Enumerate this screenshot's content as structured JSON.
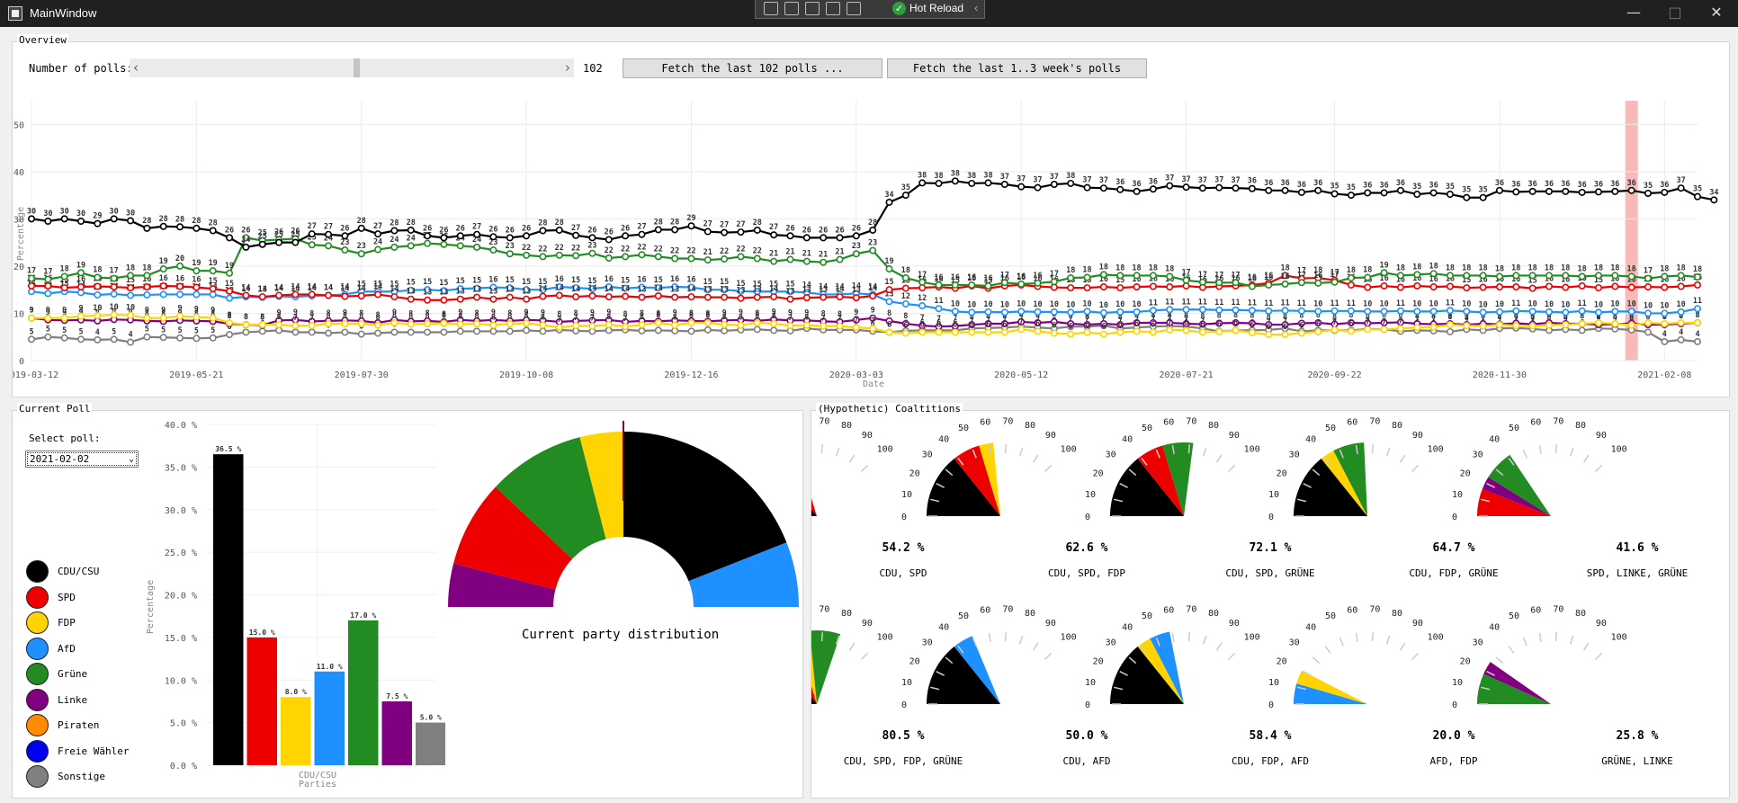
{
  "window": {
    "title": "MainWindow",
    "hot_reload": "Hot Reload",
    "minimize": "—",
    "maximize": "□",
    "close": "✕",
    "dev_icons": [
      "select-element-icon",
      "display-target-icon",
      "track-focus-icon",
      "layout-adorner-icon",
      "binding-failure-icon"
    ]
  },
  "overview": {
    "title": "Overview",
    "polls_label": "Number of polls:",
    "slider_value": "102",
    "slider_fraction": 0.51,
    "fetch_button": "Fetch the last 102 polls ...",
    "weeks_button": "Fetch the last 1..3 week's polls"
  },
  "chart": {
    "ylabel": "Percentage",
    "xlabel": "Date",
    "y_ticks": [
      "0",
      "10",
      "20",
      "30",
      "40",
      "50"
    ],
    "ylim": [
      0,
      55
    ],
    "x_ticks": [
      "2019-03-12",
      "2019-05-21",
      "2019-07-30",
      "2019-10-08",
      "2019-12-16",
      "2020-03-03",
      "2020-05-12",
      "2020-07-21",
      "2020-09-22",
      "2020-11-30",
      "2021-02-08"
    ],
    "highlight_index": 97
  },
  "chart_data": {
    "type": "line",
    "n": 102,
    "series": [
      {
        "name": "CDU/CSU",
        "color": "#000000",
        "values": [
          30,
          29.5,
          30,
          29.5,
          29,
          30,
          29.6,
          28,
          28.4,
          28.3,
          28,
          27.5,
          26,
          24,
          24.6,
          25,
          25,
          26.8,
          26.7,
          26.4,
          28,
          26.8,
          27.5,
          27.6,
          26.4,
          26,
          26.4,
          26.7,
          26.2,
          26,
          26.4,
          27.5,
          27.6,
          26.5,
          26,
          25.6,
          26.4,
          26.7,
          27.7,
          27.7,
          28.5,
          27.3,
          27.1,
          27.2,
          27.6,
          26.6,
          26.4,
          26,
          26,
          26,
          26.4,
          27.6,
          33.5,
          35,
          37.6,
          37.5,
          38,
          37.5,
          37.6,
          37.3,
          36.8,
          36.6,
          37.3,
          37.5,
          36.6,
          36.5,
          36.2,
          35.8,
          36.3,
          37,
          36.7,
          36.5,
          36.6,
          36.5,
          36.4,
          36,
          36,
          35.6,
          36,
          35.3,
          35,
          35.5,
          35.5,
          36,
          35.2,
          35.5,
          35.2,
          34.5,
          34.5,
          36,
          35.7,
          35.8,
          35.8,
          35.8,
          35.6,
          35.7,
          35.8,
          36,
          35.4,
          35.6,
          36.5,
          34.7,
          34
        ]
      },
      {
        "name": "SPD",
        "color": "#ee0000",
        "values": [
          15.8,
          15.8,
          15.4,
          15.6,
          15.7,
          15.6,
          15.4,
          15.6,
          15.8,
          15.7,
          15.5,
          15.2,
          14.7,
          13.8,
          13.5,
          13.8,
          14,
          14,
          13.8,
          13.6,
          13.7,
          14,
          13.5,
          13,
          12.8,
          12.8,
          13,
          13.4,
          13,
          13.4,
          13,
          13.6,
          13.8,
          13.5,
          13.7,
          13.5,
          13.6,
          13.4,
          13.7,
          13.4,
          13.5,
          13.4,
          13.4,
          13.2,
          13.4,
          13.5,
          13,
          13.3,
          13.4,
          13.5,
          13.3,
          13.7,
          15,
          15.3,
          15.4,
          15.6,
          15.3,
          15.8,
          15.3,
          15.8,
          16,
          15.7,
          15.5,
          15.4,
          15.4,
          15.6,
          15.4,
          15.6,
          15.7,
          15.6,
          15.8,
          15.5,
          15.7,
          15.8,
          16,
          16.4,
          18,
          17.4,
          17.5,
          17,
          16,
          15.5,
          15.8,
          15.5,
          15.8,
          15.6,
          15.7,
          15.4,
          15.5,
          15.6,
          15.6,
          15.3,
          15.7,
          15.5,
          15.8,
          15.4,
          15.7,
          15.5,
          15.6,
          15.5,
          15.7,
          16
        ]
      },
      {
        "name": "FDP",
        "color": "#ffd400",
        "values": [
          9,
          9,
          9,
          9.4,
          9.5,
          9.7,
          9.6,
          9,
          9,
          9.4,
          9.2,
          9,
          8,
          7.6,
          7.6,
          7.6,
          7.4,
          7.4,
          7.8,
          7.8,
          7.8,
          7.5,
          8,
          7.7,
          7.8,
          7.9,
          7.7,
          7.8,
          7.5,
          7.8,
          7.9,
          7.5,
          7,
          7.4,
          7.3,
          7.6,
          7.2,
          7.6,
          8,
          7.5,
          8,
          8,
          7.6,
          7.5,
          8,
          7.8,
          7.4,
          7.5,
          7.3,
          7.3,
          7,
          6.8,
          6,
          5.8,
          6,
          6,
          6,
          6,
          6,
          6,
          6.6,
          6.2,
          5.8,
          5.6,
          6,
          5.6,
          6,
          6.2,
          6,
          6.5,
          6.4,
          6,
          6.1,
          6.4,
          5.9,
          5.5,
          5.5,
          5.8,
          6.1,
          6.5,
          6.2,
          6.6,
          6.6,
          6.8,
          7,
          7.1,
          7.6,
          7.4,
          7.3,
          7.6,
          7.4,
          7.3,
          7.5,
          7.6,
          7.8,
          8,
          7.8,
          7.5,
          8,
          7.8,
          8,
          8
        ]
      },
      {
        "name": "AfD",
        "color": "#1e90ff",
        "values": [
          14.6,
          14.2,
          14.6,
          14.4,
          13.9,
          14.1,
          13.8,
          13.9,
          14,
          14,
          14,
          14,
          13.2,
          13.5,
          13.4,
          13.6,
          13.5,
          13.7,
          13.8,
          14,
          14.6,
          14.6,
          14.6,
          14.9,
          15,
          14.8,
          15.2,
          15.3,
          15.5,
          15.4,
          15,
          15,
          15.6,
          15.4,
          15.2,
          15.6,
          15.3,
          15.5,
          15.4,
          15.6,
          15.5,
          15,
          15,
          14.7,
          14.6,
          14.6,
          14.6,
          14.4,
          14,
          14,
          14.2,
          14,
          12.5,
          12,
          11.6,
          11,
          10.4,
          10.2,
          10.3,
          10.2,
          10.4,
          10.3,
          10.3,
          10.2,
          10.4,
          10.1,
          10.3,
          10.3,
          10.6,
          10.8,
          10.8,
          10.8,
          10.7,
          10.7,
          10.6,
          10.5,
          10.6,
          10.5,
          10.4,
          10.5,
          10.5,
          10.4,
          10.4,
          10.5,
          10.4,
          10.4,
          10.6,
          10.4,
          10.2,
          10.3,
          10.5,
          10.4,
          10.3,
          10.2,
          10.5,
          10.2,
          10.4,
          10.4,
          10,
          10,
          10.3,
          11
        ]
      },
      {
        "name": "Grüne",
        "color": "#228b22",
        "values": [
          17.4,
          17.2,
          17.8,
          18.6,
          17.6,
          17.4,
          18,
          18,
          19.4,
          20,
          19,
          19,
          18.5,
          26,
          25.4,
          25.6,
          25.8,
          24.5,
          24.3,
          23.4,
          22.6,
          23.5,
          24,
          24.3,
          24.8,
          24.6,
          24.3,
          24,
          23.4,
          22.6,
          22.3,
          22,
          22.3,
          22.2,
          22.7,
          21.7,
          22,
          22.4,
          22,
          21.6,
          21.6,
          21.3,
          21.5,
          22,
          21.6,
          21,
          21.4,
          21,
          20.8,
          21.4,
          22.6,
          23.3,
          19.4,
          17.5,
          16.6,
          16,
          16,
          16,
          15.8,
          16.5,
          16.2,
          16.4,
          16.7,
          17.5,
          17.6,
          18.2,
          18,
          18,
          18,
          17.8,
          17,
          16.6,
          16.5,
          16.5,
          15.7,
          16,
          16.2,
          16.5,
          16.4,
          16.6,
          17.5,
          17.6,
          18.6,
          18,
          18.2,
          18.4,
          18,
          18,
          18,
          17.8,
          18,
          18,
          18,
          18,
          17.8,
          18,
          18,
          17.8,
          17.4,
          17.8,
          18,
          17.7
        ]
      },
      {
        "name": "Linke",
        "color": "#800080",
        "values": [
          9,
          8.6,
          8.5,
          8.6,
          8.4,
          8.7,
          8.6,
          8.4,
          8.3,
          8.5,
          8.4,
          8.3,
          7.8,
          7.6,
          7.5,
          8.5,
          8.6,
          8.3,
          8.4,
          8.5,
          8.4,
          8,
          8.6,
          8.3,
          8.4,
          8.2,
          8.6,
          8.4,
          8.6,
          8.4,
          8.6,
          8.5,
          8.2,
          8.4,
          8.5,
          8.6,
          8.2,
          8.4,
          8.3,
          8.5,
          8.4,
          8.3,
          8.5,
          8.6,
          8.4,
          8.7,
          8.5,
          8.5,
          8.3,
          8.2,
          8.6,
          9,
          8.4,
          7.8,
          7.4,
          7.2,
          7.3,
          7.6,
          7.8,
          7.8,
          8.2,
          8,
          8.2,
          7.8,
          7.6,
          7.8,
          7.6,
          8,
          8,
          8,
          7.8,
          7.7,
          7.9,
          8,
          7.9,
          7.6,
          7.6,
          7.9,
          8,
          7.7,
          8,
          7.9,
          8,
          8.1,
          7.8,
          7.7,
          7.8,
          7.6,
          7.8,
          7.7,
          7.9,
          7.7,
          8,
          7.8,
          7.8,
          7.6,
          7.7,
          7.9,
          7.6,
          7.6,
          7.8,
          8
        ]
      },
      {
        "name": "Sonstige",
        "color": "#808080",
        "values": [
          4.5,
          5,
          4.8,
          4.5,
          4.4,
          4.5,
          3.9,
          5,
          4.9,
          4.8,
          4.7,
          4.8,
          5.5,
          6,
          6.2,
          6.4,
          6,
          6,
          5.8,
          6,
          5.6,
          5.8,
          6,
          6,
          6,
          6,
          6.2,
          6.2,
          6.2,
          6.2,
          6.4,
          6.2,
          6.5,
          6.3,
          6.2,
          6.4,
          6.5,
          6.3,
          6.4,
          6.3,
          6.2,
          6.5,
          6.3,
          6.5,
          6.6,
          6.4,
          6.3,
          6.8,
          6.5,
          6.5,
          6.5,
          6.2,
          6,
          6.3,
          6.4,
          6.4,
          6.4,
          6.8,
          6.9,
          7,
          7.2,
          7,
          6.8,
          7.2,
          7.2,
          7.4,
          6.8,
          7,
          7.2,
          7.3,
          7.2,
          6.8,
          6.2,
          6.4,
          6.4,
          6.5,
          6.8,
          6.2,
          6.4,
          6.4,
          6.4,
          6.7,
          6.6,
          6.2,
          6.4,
          6.3,
          6.1,
          6.6,
          6.4,
          6.8,
          6.9,
          6.7,
          6.4,
          6.6,
          6.4,
          6.8,
          6.7,
          6.5,
          6,
          4,
          4.4,
          4
        ]
      }
    ]
  },
  "current_poll": {
    "title": "Current Poll",
    "select_label": "Select poll:",
    "select_value": "2021-02-02",
    "legend": [
      {
        "name": "CDU/CSU",
        "color": "#000000"
      },
      {
        "name": "SPD",
        "color": "#ee0000"
      },
      {
        "name": "FDP",
        "color": "#ffd400"
      },
      {
        "name": "AfD",
        "color": "#1e90ff"
      },
      {
        "name": "Grüne",
        "color": "#228b22"
      },
      {
        "name": "Linke",
        "color": "#800080"
      },
      {
        "name": "Piraten",
        "color": "#ff8c00"
      },
      {
        "name": "Freie Wähler",
        "color": "#0000ee"
      },
      {
        "name": "Sonstige",
        "color": "#808080"
      }
    ],
    "bar_chart": {
      "ylabel": "Percentage",
      "xlabel": "Parties",
      "x_tick": "CDU/CSU",
      "y_ticks": [
        "0.0 %",
        "5.0 %",
        "10.0 %",
        "15.0 %",
        "20.0 %",
        "25.0 %",
        "30.0 %",
        "35.0 %",
        "40.0 %"
      ],
      "ylim": [
        0,
        40
      ],
      "bars": [
        {
          "label": "36.5 %",
          "value": 36.5,
          "color": "#000000"
        },
        {
          "label": "15.0 %",
          "value": 15.0,
          "color": "#ee0000"
        },
        {
          "label": "8.0 %",
          "value": 8.0,
          "color": "#ffd400"
        },
        {
          "label": "11.0 %",
          "value": 11.0,
          "color": "#1e90ff"
        },
        {
          "label": "17.0 %",
          "value": 17.0,
          "color": "#228b22"
        },
        {
          "label": "7.5 %",
          "value": 7.5,
          "color": "#800080"
        },
        {
          "label": "5.0 %",
          "value": 5.0,
          "color": "#808080"
        }
      ]
    },
    "distribution_title": "Current party distribution",
    "distribution": [
      {
        "name": "Linke",
        "value": 8,
        "color": "#800080"
      },
      {
        "name": "SPD",
        "value": 16,
        "color": "#ee0000"
      },
      {
        "name": "Grüne",
        "value": 18,
        "color": "#228b22"
      },
      {
        "name": "FDP",
        "value": 8,
        "color": "#ffd400"
      },
      {
        "name": "CDU/CSU",
        "value": 38,
        "color": "#000000"
      },
      {
        "name": "AfD",
        "value": 12,
        "color": "#1e90ff"
      }
    ]
  },
  "coalitions": {
    "title": "(Hypothetic) Coaltitions",
    "gauges": [
      {
        "total": "54.2 %",
        "parties": "CDU, SPD",
        "segments": [
          {
            "v": 38,
            "c": "#000000"
          },
          {
            "v": 16.2,
            "c": "#ee0000"
          }
        ]
      },
      {
        "total": "62.6 %",
        "parties": "CDU, SPD, FDP",
        "segments": [
          {
            "v": 38,
            "c": "#000000"
          },
          {
            "v": 16.2,
            "c": "#ee0000"
          },
          {
            "v": 8.4,
            "c": "#ffd400"
          }
        ]
      },
      {
        "total": "72.1 %",
        "parties": "CDU, SPD, GRÜNE",
        "segments": [
          {
            "v": 38,
            "c": "#000000"
          },
          {
            "v": 16.2,
            "c": "#ee0000"
          },
          {
            "v": 17.9,
            "c": "#228b22"
          }
        ]
      },
      {
        "total": "64.7 %",
        "parties": "CDU, FDP, GRÜNE",
        "segments": [
          {
            "v": 38,
            "c": "#000000"
          },
          {
            "v": 8.4,
            "c": "#ffd400"
          },
          {
            "v": 18.3,
            "c": "#228b22"
          }
        ]
      },
      {
        "total": "41.6 %",
        "parties": "SPD, LINKE, GRÜNE",
        "segments": [
          {
            "v": 16,
            "c": "#ee0000"
          },
          {
            "v": 7.7,
            "c": "#800080"
          },
          {
            "v": 17.9,
            "c": "#228b22"
          }
        ]
      },
      {
        "total": "80.5 %",
        "parties": "CDU, SPD, FDP, GRÜNE",
        "segments": [
          {
            "v": 38,
            "c": "#000000"
          },
          {
            "v": 16.2,
            "c": "#ee0000"
          },
          {
            "v": 8.4,
            "c": "#ffd400"
          },
          {
            "v": 17.9,
            "c": "#228b22"
          }
        ]
      },
      {
        "total": "50.0 %",
        "parties": "CDU, AFD",
        "segments": [
          {
            "v": 38,
            "c": "#000000"
          },
          {
            "v": 12,
            "c": "#1e90ff"
          }
        ]
      },
      {
        "total": "58.4 %",
        "parties": "CDU, FDP, AFD",
        "segments": [
          {
            "v": 38,
            "c": "#000000"
          },
          {
            "v": 8.4,
            "c": "#ffd400"
          },
          {
            "v": 12,
            "c": "#1e90ff"
          }
        ]
      },
      {
        "total": "20.0 %",
        "parties": "AFD, FDP",
        "segments": [
          {
            "v": 12,
            "c": "#1e90ff"
          },
          {
            "v": 8,
            "c": "#ffd400"
          }
        ]
      },
      {
        "total": "25.8 %",
        "parties": "GRÜNE, LINKE",
        "segments": [
          {
            "v": 17.9,
            "c": "#228b22"
          },
          {
            "v": 7.9,
            "c": "#800080"
          }
        ]
      }
    ],
    "scale_labels": [
      "0",
      "10",
      "20",
      "30",
      "40",
      "50",
      "60",
      "70",
      "80",
      "90",
      "100"
    ]
  }
}
